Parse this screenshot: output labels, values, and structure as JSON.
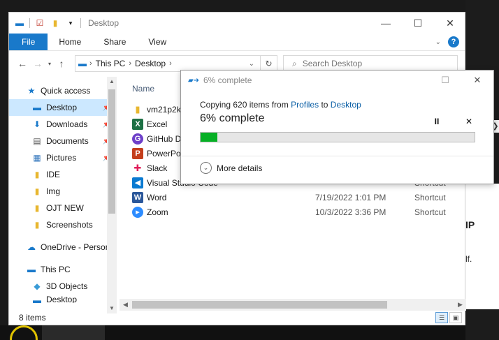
{
  "explorer": {
    "title": "Desktop",
    "ribbon_tabs": [
      "File",
      "Home",
      "Share",
      "View"
    ],
    "help_label": "?",
    "address": {
      "crumbs": [
        "This PC",
        "Desktop"
      ]
    },
    "search": {
      "placeholder": "Search Desktop"
    },
    "nav": {
      "items": [
        {
          "label": "Quick access",
          "icon": "star-icon",
          "pinned": false
        },
        {
          "label": "Desktop",
          "icon": "desktop-icon",
          "pinned": true,
          "selected": true
        },
        {
          "label": "Downloads",
          "icon": "download-icon",
          "pinned": true
        },
        {
          "label": "Documents",
          "icon": "documents-icon",
          "pinned": true
        },
        {
          "label": "Pictures",
          "icon": "pictures-icon",
          "pinned": true
        },
        {
          "label": "IDE",
          "icon": "folder-icon",
          "pinned": false
        },
        {
          "label": "Img",
          "icon": "folder-icon",
          "pinned": false
        },
        {
          "label": "OJT NEW",
          "icon": "folder-icon",
          "pinned": false
        },
        {
          "label": "Screenshots",
          "icon": "folder-icon",
          "pinned": false
        }
      ],
      "onedrive": "OneDrive - Person",
      "thispc": "This PC",
      "objects3d": "3D Objects",
      "partial": "Desktop"
    },
    "columns": {
      "name": "Name"
    },
    "files": [
      {
        "name": "vm21p2k",
        "icon": "folder-icon",
        "date": "",
        "type": ""
      },
      {
        "name": "Excel",
        "icon": "excel-icon",
        "date": "",
        "type": ""
      },
      {
        "name": "GitHub Desktop",
        "icon": "github-icon",
        "date": "",
        "type": ""
      },
      {
        "name": "PowerPoint",
        "icon": "powerpoint-icon",
        "date": "",
        "type": ""
      },
      {
        "name": "Slack",
        "icon": "slack-icon",
        "date": "",
        "type": ""
      },
      {
        "name": "Visual Studio Code",
        "icon": "vscode-icon",
        "date": "",
        "type": "Shortcut"
      },
      {
        "name": "Word",
        "icon": "word-icon",
        "date": "7/19/2022 1:01 PM",
        "type": "Shortcut"
      },
      {
        "name": "Zoom",
        "icon": "zoom-icon",
        "date": "10/3/2022 3:36 PM",
        "type": "Shortcut"
      }
    ],
    "status": {
      "count": "8 items"
    }
  },
  "dialog": {
    "title": "6% complete",
    "copy_prefix": "Copying 620 items from",
    "source": "Profiles",
    "to_word": "to",
    "dest": "Desktop",
    "percent_text": "6% complete",
    "progress": 0.06,
    "more_details": "More details",
    "pause_label": "II",
    "cancel_label": "✕"
  },
  "background": {
    "text1": "IP",
    "text2": "lf."
  },
  "colors": {
    "accent": "#1979ca",
    "progress": "#06b025",
    "selected": "#cce8ff"
  }
}
